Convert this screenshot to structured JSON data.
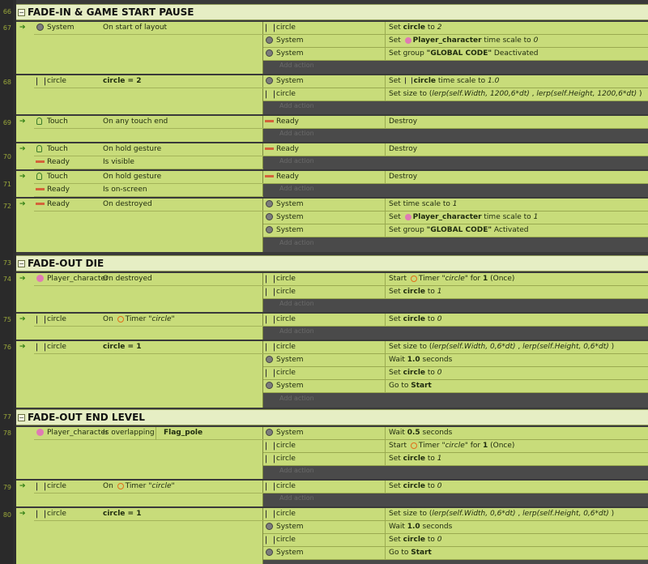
{
  "line_numbers": [
    "66",
    "67",
    "68",
    "69",
    "70",
    "71",
    "72",
    "73",
    "74",
    "75",
    "76",
    "77",
    "78",
    "79",
    "80"
  ],
  "add_action_label": "Add action",
  "groups": [
    {
      "title": "FADE-IN & GAME START PAUSE"
    },
    {
      "title": "FADE-OUT DIE"
    },
    {
      "title": "FADE-OUT END LEVEL"
    }
  ],
  "events": {
    "e67": {
      "conditions": [
        {
          "object": "System",
          "text": "On start of layout"
        }
      ],
      "actions": [
        {
          "object": "circle",
          "text": "Set circle to 2"
        },
        {
          "object": "System",
          "text": "Set Player_character time scale to 0"
        },
        {
          "object": "System",
          "text": "Set group \"GLOBAL CODE\" Deactivated"
        }
      ]
    },
    "e68": {
      "conditions": [
        {
          "object": "circle",
          "text": "circle = 2"
        }
      ],
      "actions": [
        {
          "object": "System",
          "text": "Set circle time scale to 1.0"
        },
        {
          "object": "circle",
          "text": "Set size to (lerp(self.Width, 1200,6*dt) , lerp(self.Height, 1200,6*dt) )"
        }
      ]
    },
    "e69": {
      "conditions": [
        {
          "object": "Touch",
          "text": "On any touch end"
        }
      ],
      "actions": [
        {
          "object": "Ready",
          "text": "Destroy"
        }
      ]
    },
    "e70": {
      "conditions": [
        {
          "object": "Touch",
          "text": "On hold gesture"
        },
        {
          "object": "Ready",
          "text": "Is visible"
        }
      ],
      "actions": [
        {
          "object": "Ready",
          "text": "Destroy"
        }
      ]
    },
    "e71": {
      "conditions": [
        {
          "object": "Touch",
          "text": "On hold gesture"
        },
        {
          "object": "Ready",
          "text": "Is on-screen"
        }
      ],
      "actions": [
        {
          "object": "Ready",
          "text": "Destroy"
        }
      ]
    },
    "e72": {
      "conditions": [
        {
          "object": "Ready",
          "text": "On destroyed"
        }
      ],
      "actions": [
        {
          "object": "System",
          "text": "Set time scale to 1"
        },
        {
          "object": "System",
          "text": "Set Player_character time scale to 1"
        },
        {
          "object": "System",
          "text": "Set group \"GLOBAL CODE\" Activated"
        }
      ]
    },
    "e74": {
      "conditions": [
        {
          "object": "Player_character",
          "text": "On destroyed"
        }
      ],
      "actions": [
        {
          "object": "circle",
          "text": "Start Timer \"circle\" for 1 (Once)"
        },
        {
          "object": "circle",
          "text": "Set circle to 1"
        }
      ]
    },
    "e75": {
      "conditions": [
        {
          "object": "circle",
          "text": "On Timer \"circle\""
        }
      ],
      "actions": [
        {
          "object": "circle",
          "text": "Set circle to 0"
        }
      ]
    },
    "e76": {
      "conditions": [
        {
          "object": "circle",
          "text": "circle = 1"
        }
      ],
      "actions": [
        {
          "object": "circle",
          "text": "Set size to (lerp(self.Width, 0,6*dt) , lerp(self.Height, 0,6*dt) )"
        },
        {
          "object": "System",
          "text": "Wait 1.0 seconds"
        },
        {
          "object": "circle",
          "text": "Set circle to 0"
        },
        {
          "object": "System",
          "text": "Go to Start"
        }
      ]
    },
    "e78": {
      "conditions": [
        {
          "object": "Player_character",
          "text": "Is overlapping",
          "param": "Flag_pole"
        }
      ],
      "actions": [
        {
          "object": "System",
          "text": "Wait 0.5 seconds"
        },
        {
          "object": "circle",
          "text": "Start Timer \"circle\" for 1 (Once)"
        },
        {
          "object": "circle",
          "text": "Set circle to 1"
        }
      ]
    },
    "e79": {
      "conditions": [
        {
          "object": "circle",
          "text": "On Timer \"circle\""
        }
      ],
      "actions": [
        {
          "object": "circle",
          "text": "Set circle to 0"
        }
      ]
    },
    "e80": {
      "conditions": [
        {
          "object": "circle",
          "text": "circle = 1"
        }
      ],
      "actions": [
        {
          "object": "circle",
          "text": "Set size to (lerp(self.Width, 0,6*dt) , lerp(self.Height, 0,6*dt) )"
        },
        {
          "object": "System",
          "text": "Wait 1.0 seconds"
        },
        {
          "object": "circle",
          "text": "Set circle to 0"
        },
        {
          "object": "System",
          "text": "Go to Start"
        }
      ]
    }
  }
}
